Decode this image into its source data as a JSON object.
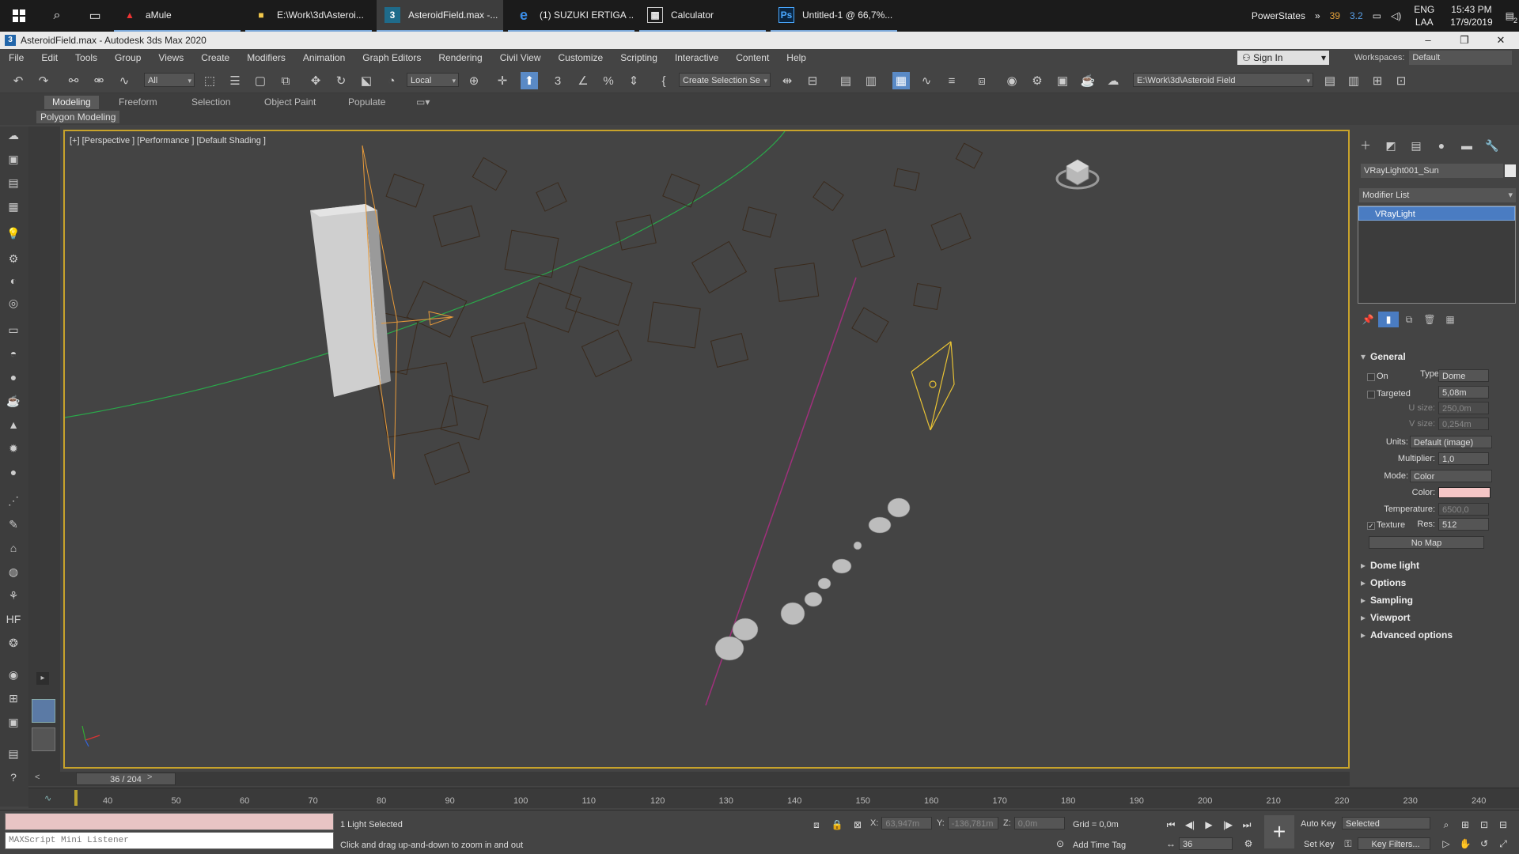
{
  "taskbar": {
    "apps": [
      {
        "label": "aMule",
        "icon": "amule-icon"
      },
      {
        "label": "E:\\Work\\3d\\Asteroi...",
        "icon": "folder-icon"
      },
      {
        "label": "AsteroidField.max -...",
        "icon": "3dsmax-icon",
        "active": true
      },
      {
        "label": "(1) SUZUKI ERTIGA ...",
        "icon": "edge-icon"
      },
      {
        "label": "Calculator",
        "icon": "calculator-icon"
      },
      {
        "label": "Untitled-1 @ 66,7%...",
        "icon": "photoshop-icon"
      }
    ],
    "tray": {
      "powerstates": "PowerStates",
      "temp1": "39",
      "temp2": "3.2",
      "lang1": "ENG",
      "lang2": "LAA",
      "time": "15:43 PM",
      "date": "17/9/2019",
      "notifications": "2"
    }
  },
  "window": {
    "title": "AsteroidField.max - Autodesk 3ds Max 2020"
  },
  "menu": [
    "File",
    "Edit",
    "Tools",
    "Group",
    "Views",
    "Create",
    "Modifiers",
    "Animation",
    "Graph Editors",
    "Rendering",
    "Civil View",
    "Customize",
    "Scripting",
    "Interactive",
    "Content",
    "Help"
  ],
  "signin": "Sign In",
  "workspaces": {
    "label": "Workspaces:",
    "value": "Default"
  },
  "toolbar": {
    "filter": "All",
    "refcoord": "Local",
    "selection_set": "Create Selection Se",
    "project_path": "E:\\Work\\3d\\Asteroid Field"
  },
  "ribbon": {
    "tabs": [
      "Modeling",
      "Freeform",
      "Selection",
      "Object Paint",
      "Populate"
    ],
    "subpanel": "Polygon Modeling"
  },
  "viewport": {
    "label": "[+] [Perspective ] [Performance ] [Default Shading ]"
  },
  "command_panel": {
    "object_name": "VRayLight001_Sun",
    "modifier_list": "Modifier List",
    "stack_items": [
      "VRayLight"
    ],
    "general": {
      "title": "General",
      "on": "On",
      "type_label": "Type:",
      "type_value": "Dome",
      "targeted": "Targeted",
      "targeted_value": "5,08m",
      "usize_label": "U size:",
      "usize_value": "250,0m",
      "vsize_label": "V size:",
      "vsize_value": "0,254m",
      "units_label": "Units:",
      "units_value": "Default (image)",
      "multiplier_label": "Multiplier:",
      "multiplier_value": "1,0",
      "mode_label": "Mode:",
      "mode_value": "Color",
      "color_label": "Color:",
      "color_swatch": "#f5c6c6",
      "temperature_label": "Temperature:",
      "temperature_value": "6500,0",
      "texture_label": "Texture",
      "res_label": "Res:",
      "res_value": "512",
      "nomap": "No Map"
    },
    "rollouts": [
      "Dome light",
      "Options",
      "Sampling",
      "Viewport",
      "Advanced options"
    ]
  },
  "timeline": {
    "frame": "36 / 204",
    "ticks": [
      "40",
      "50",
      "60",
      "70",
      "80",
      "90",
      "100",
      "110",
      "120",
      "130",
      "140",
      "150",
      "160",
      "170",
      "180",
      "190",
      "200",
      "210",
      "220",
      "230",
      "240"
    ]
  },
  "status": {
    "maxscript": "MAXScript Mini Listener",
    "selected": "1 Light Selected",
    "prompt": "Click and drag up-and-down to zoom in and out",
    "x_label": "X:",
    "x_value": "63,947m",
    "y_label": "Y:",
    "y_value": "-136,781m",
    "z_label": "Z:",
    "z_value": "0,0m",
    "grid": "Grid = 0,0m",
    "add_time_tag": "Add Time Tag",
    "auto_key": "Auto Key",
    "set_key": "Set Key",
    "key_mode": "Selected",
    "key_filters": "Key Filters...",
    "current_frame": "36"
  }
}
